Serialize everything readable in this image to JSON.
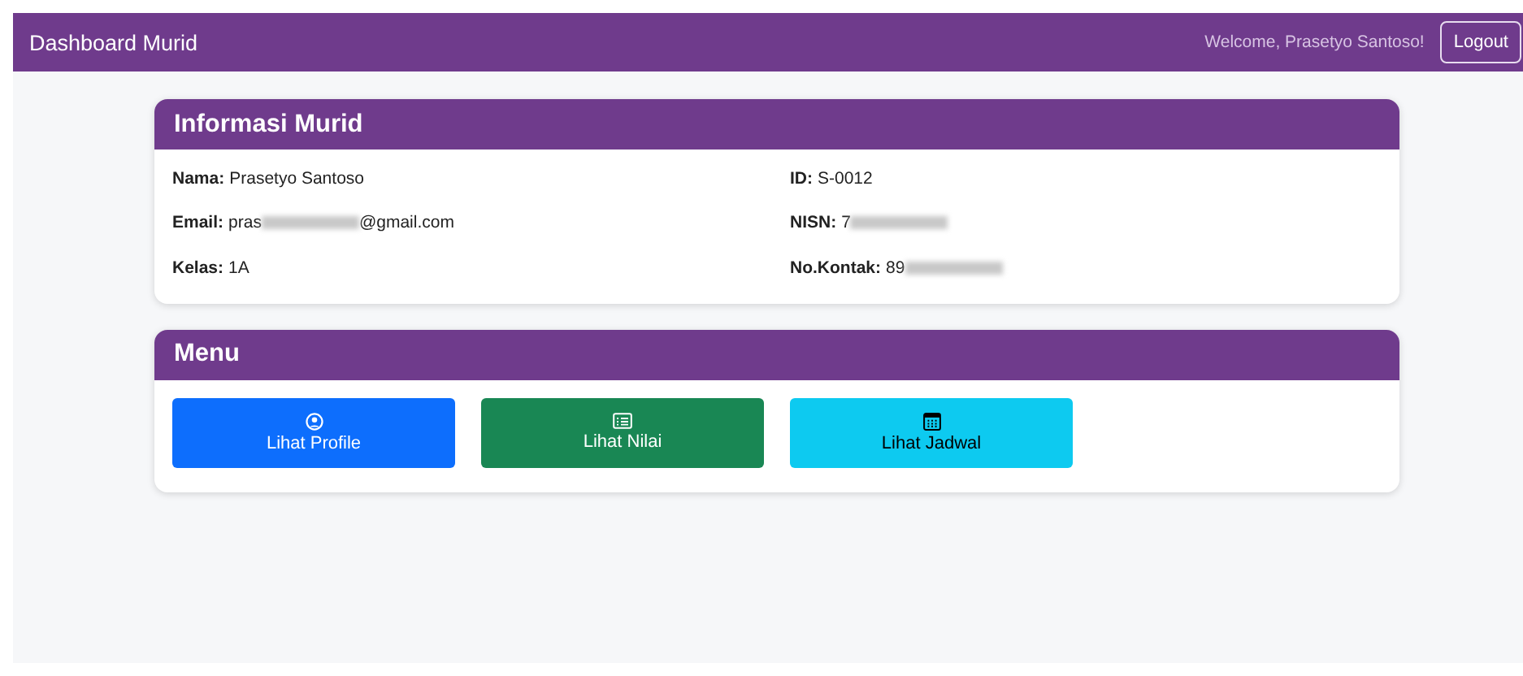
{
  "navbar": {
    "title": "Dashboard Murid",
    "welcome": "Welcome, Prasetyo Santoso!",
    "logout": "Logout"
  },
  "info_card": {
    "title": "Informasi Murid",
    "fields": [
      {
        "label": "Nama:",
        "value": "Prasetyo Santoso",
        "redacted": false
      },
      {
        "label": "ID:",
        "value": "S-0012",
        "redacted": false
      },
      {
        "label": "Email:",
        "value": "pras",
        "value_end": "@gmail.com",
        "redacted": true
      },
      {
        "label": "NISN:",
        "value": "7",
        "redacted": true
      },
      {
        "label": "Kelas:",
        "value": "1A",
        "redacted": false
      },
      {
        "label": "No.Kontak:",
        "value": "89",
        "redacted": true
      }
    ]
  },
  "menu_card": {
    "title": "Menu",
    "buttons": [
      {
        "label": "Lihat Profile",
        "kind": "profile",
        "color": "#0d6efd"
      },
      {
        "label": "Lihat Nilai",
        "kind": "grades",
        "color": "#198754"
      },
      {
        "label": "Lihat Jadwal",
        "kind": "schedule",
        "color": "#0dcaf0"
      }
    ]
  }
}
